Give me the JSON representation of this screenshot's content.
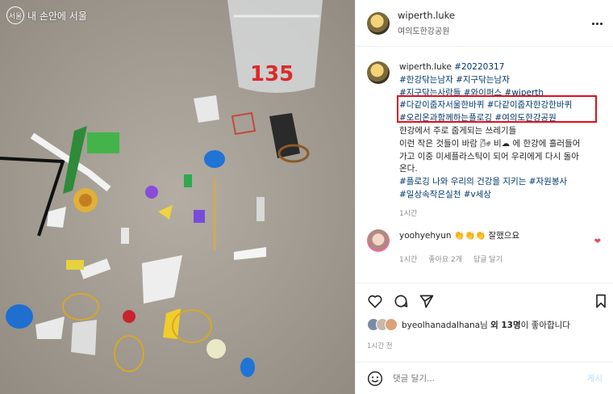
{
  "photo": {
    "watermark_text": "내 손안에 서울",
    "cup_number": "135"
  },
  "post": {
    "username": "wiperth.luke",
    "location": "여의도한강공원"
  },
  "caption": {
    "username": "wiperth.luke",
    "lines": [
      "#20220317",
      "#한강닦는남자 #지구닦는남자",
      "#지구닦는사람들 #와이퍼스 #wiperth",
      "#다같이줍자서울한바퀴 #다같이줍자한강한바퀴",
      "#오리온과함께하는플로깅 #여의도한강공원",
      "한강에서 주로 줍게되는 쓰레기들",
      "이런 작은 것들이 바람 🌬 비☁ 에 한강에 흘러들어",
      "가고 이중 미세플라스틱이 되어 우리에게 다시 돌아",
      "온다.",
      "#플로깅 나와 우리의 건강을 지키는 #자원봉사",
      "#일상속작은실천 #v세상"
    ],
    "time": "1시간"
  },
  "comment": {
    "username": "yoohyehyun",
    "text": "👏👏👏 잘했으요",
    "time": "1시간",
    "likes": "좋아요 2개",
    "reply": "답글 달기"
  },
  "likes": {
    "user": "byeolhanadalhana",
    "suffix1": "님 ",
    "bold": "외 13명",
    "suffix2": "이 좋아합니다"
  },
  "post_time": "1시간 전",
  "comment_box": {
    "placeholder": "댓글 달기...",
    "post_label": "게시"
  },
  "colors": {
    "highlight": "#e0101a",
    "hashtag": "#00376b",
    "heart": "#ed4956"
  }
}
